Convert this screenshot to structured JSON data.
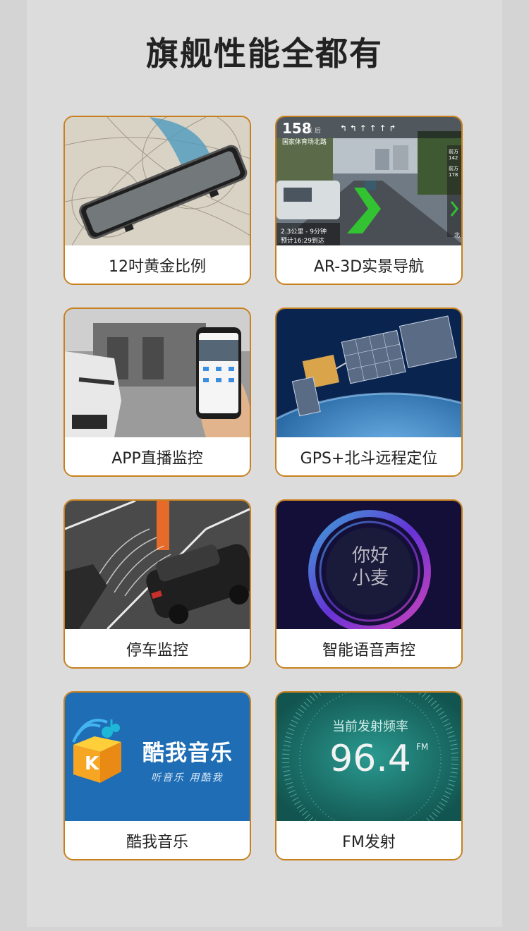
{
  "page": {
    "title": "旗舰性能全都有"
  },
  "features": [
    {
      "label": "12吋黄金比例"
    },
    {
      "label": "AR-3D实景导航"
    },
    {
      "label": "APP直播监控"
    },
    {
      "label": "GPS+北斗远程定位"
    },
    {
      "label": "停车监控"
    },
    {
      "label": "智能语音声控"
    },
    {
      "label": "酷我音乐"
    },
    {
      "label": "FM发射"
    }
  ],
  "nav_image": {
    "speed": "158",
    "speed_unit": "米 后",
    "road": "国家体育场北路",
    "distance": "2.3公里 - 9分钟",
    "arrival": "预计16:29到达",
    "side_1": "前方142",
    "side_2": "前方178",
    "side_3": "北"
  },
  "voice_image": {
    "line1": "你好",
    "line2": "小麦"
  },
  "music_image": {
    "brand": "酷我音乐",
    "slogan": "听音乐 用酷我",
    "logo_letter": "K"
  },
  "fm_image": {
    "caption": "当前发射频率",
    "frequency": "96.4",
    "unit": "FM"
  },
  "colors": {
    "card_border": "#c8801e",
    "page_bg": "#dcdcdc",
    "music_bg": "#1e6db5"
  }
}
